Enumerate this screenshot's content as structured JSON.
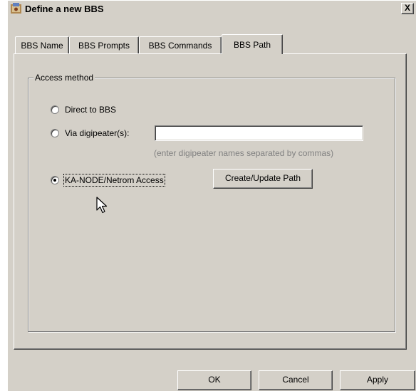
{
  "window": {
    "title": "Define a new BBS",
    "close_glyph": "X"
  },
  "tabs": [
    {
      "label": "BBS Name",
      "active": false
    },
    {
      "label": "BBS Prompts",
      "active": false
    },
    {
      "label": "BBS Commands",
      "active": false
    },
    {
      "label": "BBS Path",
      "active": true
    }
  ],
  "access_group": {
    "label": "Access method",
    "options": [
      {
        "label": "Direct to BBS",
        "checked": false
      },
      {
        "label": "Via digipeater(s):",
        "checked": false
      },
      {
        "label": "KA-NODE/Netrom Access",
        "checked": true
      }
    ],
    "digipeater_field": {
      "value": "",
      "hint": "(enter digipeater names separated by commas)"
    },
    "create_update_button": "Create/Update Path"
  },
  "footer": {
    "ok_label": "OK",
    "cancel_label": "Cancel",
    "apply_label": "Apply"
  },
  "colors": {
    "dialog_face": "#d4d0c8",
    "hint_text": "#808080"
  },
  "icons": {
    "app": "bbs-app-icon",
    "cursor": "mouse-pointer-icon"
  }
}
